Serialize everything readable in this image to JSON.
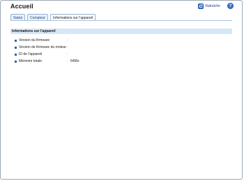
{
  "header": {
    "title": "Accueil",
    "refresh_label": "Rafraîchir",
    "help_label": "?"
  },
  "tabs": [
    {
      "label": "Statut",
      "active": false
    },
    {
      "label": "Compteur",
      "active": false
    },
    {
      "label": "Informations sur l'appareil",
      "active": true
    }
  ],
  "section": {
    "title": "Informations sur l'appareil",
    "rows": [
      {
        "label": "Version du firmware",
        "separator": ":",
        "value": ""
      },
      {
        "label": "Version de firmware du moteur",
        "separator": ":",
        "value": ""
      },
      {
        "label": "ID de l'appareil",
        "separator": ":",
        "value": ""
      },
      {
        "label": "Mémoire totale",
        "separator": ":",
        "value": "64Mo"
      }
    ]
  },
  "colors": {
    "accent": "#3d75c4",
    "section_bg": "#d6e8f7",
    "tab_bg": "#eaf1fb"
  }
}
